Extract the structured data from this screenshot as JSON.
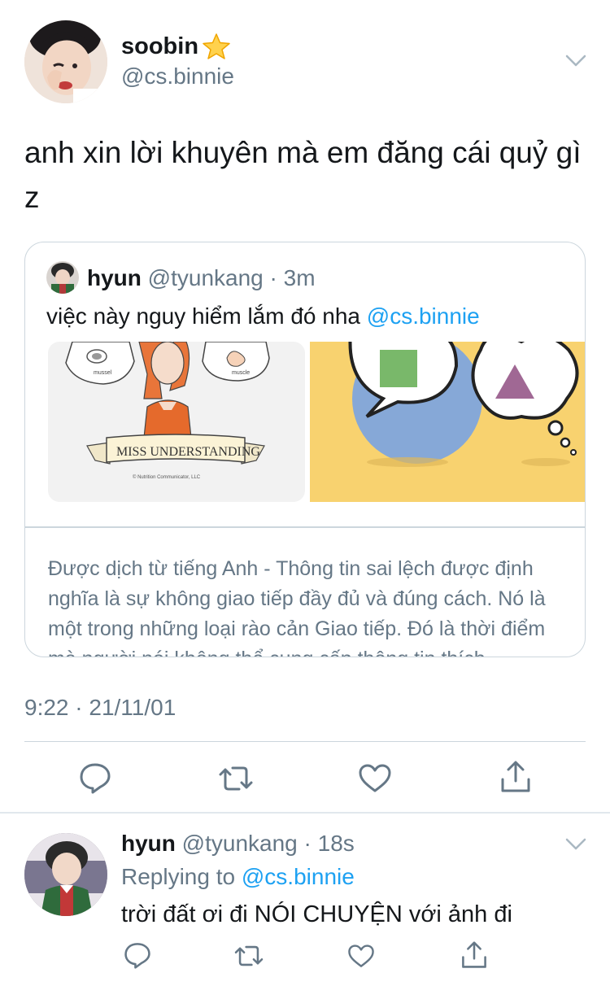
{
  "tweet": {
    "author_name": "soobin",
    "author_badge": "star-emoji",
    "author_handle": "@cs.binnie",
    "text": "anh xin lời khuyên mà em đăng cái quỷ gì z",
    "timestamp": "9:22 · 21/11/01"
  },
  "quote": {
    "name": "hyun",
    "handle": "@tyunkang",
    "separator": " · ",
    "time": "3m",
    "text": "việc này nguy hiểm lắm đó nha ",
    "mention": "@cs.binnie",
    "image_left_caption": "MISS UNDERSTANDING",
    "image_left_label_a": "mussel",
    "image_left_label_b": "muscle",
    "image_left_credit": "© Nutrition Communicator, LLC",
    "translation": "Được dịch từ tiếng Anh - Thông tin sai lệch được định nghĩa là sự không giao tiếp đầy đủ và đúng cách. Nó là một trong những loại rào cản Giao tiếp. Đó là thời điểm mà người nói không thể cung cấp thông tin thích"
  },
  "actions": {
    "icons": [
      "reply-icon",
      "retweet-icon",
      "like-icon",
      "share-icon"
    ]
  },
  "reply": {
    "name": "hyun",
    "handle": "@tyunkang",
    "separator": " · ",
    "time": "18s",
    "replying_prefix": "Replying to ",
    "replying_mention": "@cs.binnie",
    "text": "trời đất ơi đi NÓI CHUYỆN với ảnh đi"
  },
  "colors": {
    "text": "#14171a",
    "secondary": "#657786",
    "link": "#1da1f2",
    "border": "#ccd6dd"
  }
}
